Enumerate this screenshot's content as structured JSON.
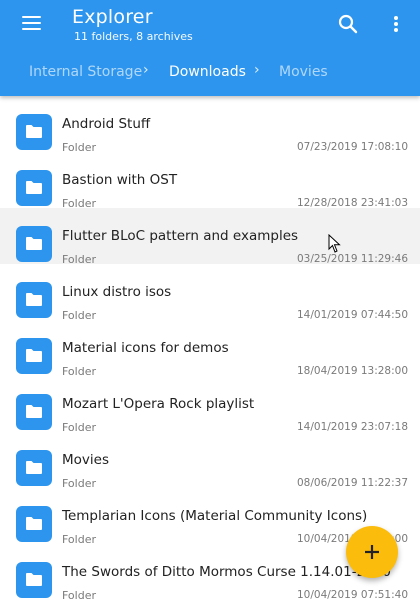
{
  "appbar": {
    "title": "Explorer",
    "subtitle": "11 folders, 8 archives",
    "color": "#2d95ee"
  },
  "breadcrumb": [
    "Internal Storage",
    "Downloads",
    "Movies"
  ],
  "files": [
    {
      "name": "Android Stuff",
      "kind": "Folder",
      "date": "07/23/2019 17:08:10"
    },
    {
      "name": "Bastion with OST",
      "kind": "Folder",
      "date": "12/28/2018 23:41:03"
    },
    {
      "name": "Flutter BLoC pattern and examples",
      "kind": "Folder",
      "date": "03/25/2019 11:29:46"
    },
    {
      "name": "Linux distro isos",
      "kind": "Folder",
      "date": "14/01/2019 07:44:50"
    },
    {
      "name": "Material icons for demos",
      "kind": "Folder",
      "date": "18/04/2019 13:28:00"
    },
    {
      "name": "Mozart L'Opera Rock playlist",
      "kind": "Folder",
      "date": "14/01/2019 23:07:18"
    },
    {
      "name": "Movies",
      "kind": "Folder",
      "date": "08/06/2019 11:22:37"
    },
    {
      "name": "Templarian Icons (Material Community Icons)",
      "kind": "Folder",
      "date": "10/04/2019 18:24:00"
    },
    {
      "name": "The Swords of Ditto Mormos Curse 1.14.01-2020",
      "kind": "Folder",
      "date": "10/04/2019 07:51:40"
    }
  ],
  "fab": {
    "icon": "plus-icon",
    "color": "#fbbc0c"
  }
}
